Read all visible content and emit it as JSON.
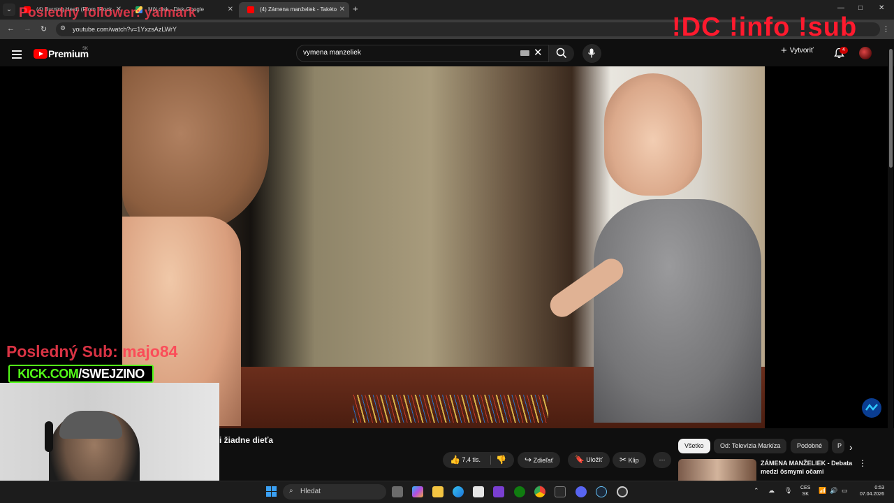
{
  "browser": {
    "tabs": [
      {
        "title": "(4) Burning Heart (From \"Rock",
        "active": false,
        "favicon": "youtube-favicon"
      },
      {
        "title": "Môj disk - Disk Google",
        "active": false,
        "favicon": "google-drive-favicon"
      },
      {
        "title": "(4) Zámena manželiek - Takéto",
        "active": true,
        "favicon": "youtube-favicon"
      }
    ],
    "tab_menu_icon": "chevron-down-icon",
    "new_tab_icon": "+",
    "window_controls": [
      "—",
      "□",
      "✕"
    ],
    "url": "youtube.com/watch?v=1YxzsAzLWrY",
    "nav_icons": [
      "back-icon",
      "forward-icon",
      "reload-icon",
      "site-info-icon"
    ]
  },
  "overlays": {
    "follower": "Posledný follower: yalmark",
    "commands": "!DC !info !sub",
    "last_sub": "Posledný Sub: majo84",
    "kick_prefix": "KICK.COM",
    "kick_suffix": "/SWEJZINO"
  },
  "youtube": {
    "brand": "Premium",
    "brand_region": "SK",
    "search_value": "vymena manzeliek",
    "create_label": "Vytvoriť",
    "notification_count": "4",
    "video_title_visible": "i žiadne dieťa",
    "actions": {
      "likes": "7,4 tis.",
      "share": "Zdieľať",
      "save": "Uložiť",
      "clip": "Klip",
      "more": "⋯"
    },
    "chips": [
      {
        "label": "Všetko",
        "selected": true
      },
      {
        "label": "Od: Televízia Markíza",
        "selected": false
      },
      {
        "label": "Podobné",
        "selected": false
      },
      {
        "label": "P",
        "selected": false
      }
    ],
    "recommendation": {
      "title": "ZÁMENA MANŽELIEK - Debata medzi ôsmymi očami"
    }
  },
  "taskbar": {
    "search_placeholder": "Hledat",
    "language": [
      "CES",
      "SK"
    ],
    "time": "0:53",
    "date": "07.04.2026",
    "apps": [
      "task-view-icon",
      "copilot-icon",
      "file-explorer-icon",
      "edge-icon",
      "store-icon",
      "app-icon",
      "xbox-icon",
      "chrome-icon",
      "epic-games-icon",
      "discord-icon",
      "steam-icon",
      "obs-icon"
    ]
  },
  "colors": {
    "youtube_red": "#ff0000",
    "overlay_red": "#ff1a2e",
    "kick_green": "#53fc18",
    "page_bg": "#0f0f0f"
  }
}
